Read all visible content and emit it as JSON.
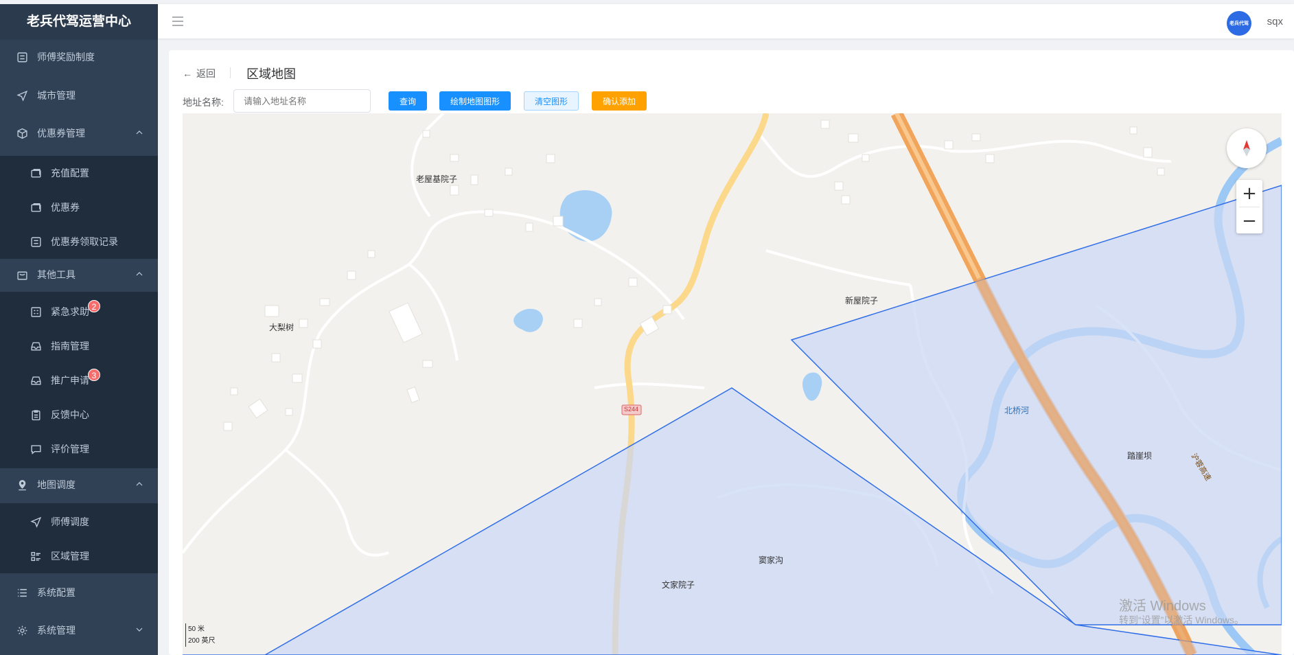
{
  "sidebar": {
    "brand": "老兵代驾运营中心",
    "items": [
      {
        "label": "师傅奖励制度",
        "icon": "list-icon"
      },
      {
        "label": "城市管理",
        "icon": "send-icon"
      },
      {
        "label": "优惠券管理",
        "icon": "box-icon",
        "expanded": true
      },
      {
        "label": "充值配置",
        "icon": "ticket-icon"
      },
      {
        "label": "优惠券",
        "icon": "ticket-icon"
      },
      {
        "label": "优惠券领取记录",
        "icon": "list-icon"
      },
      {
        "label": "其他工具",
        "icon": "bag-icon",
        "expanded": true
      },
      {
        "label": "紧急求助",
        "icon": "checklist-icon",
        "badge": "2"
      },
      {
        "label": "指南管理",
        "icon": "inbox-icon"
      },
      {
        "label": "推广申请",
        "icon": "inbox-icon",
        "badge": "3"
      },
      {
        "label": "反馈中心",
        "icon": "clipboard-icon"
      },
      {
        "label": "评价管理",
        "icon": "chat-icon"
      },
      {
        "label": "地图调度",
        "icon": "location-icon",
        "expanded": true
      },
      {
        "label": "师傅调度",
        "icon": "send-icon"
      },
      {
        "label": "区域管理",
        "icon": "grid-list-icon"
      },
      {
        "label": "系统配置",
        "icon": "menu-list-icon"
      },
      {
        "label": "系统管理",
        "icon": "gear-icon",
        "expanded": false
      }
    ]
  },
  "header": {
    "avatar_text": "老兵代驾",
    "username": "sqx"
  },
  "page": {
    "back_label": "返回",
    "title": "区域地图",
    "address_label": "地址名称:",
    "address_placeholder": "请输入地址名称",
    "address_value": "",
    "btn_query": "查询",
    "btn_draw": "绘制地图图形",
    "btn_clear": "清空图形",
    "btn_confirm": "确认添加"
  },
  "map": {
    "labels": {
      "laowu": "老屋基院子",
      "dali": "大梨树",
      "xinwu": "新屋院子",
      "beiqiao": "北桥河",
      "luya": "踏崖坝",
      "doujia": "窦家沟",
      "wenjia": "文家院子",
      "highway": "沪蓉高速",
      "road": "S244"
    },
    "scale_m": "50 米",
    "scale_ft": "200 英尺",
    "zoom_in": "+",
    "zoom_out": "−",
    "colors": {
      "polygon_fill": "#c9d7f5",
      "polygon_stroke": "#2f6ee8",
      "water": "#9cc8f5",
      "highway": "#f0a55a",
      "road": "#fbd88a"
    }
  },
  "watermark": {
    "line1": "激活 Windows",
    "line2": "转到“设置”以激活 Windows。"
  }
}
